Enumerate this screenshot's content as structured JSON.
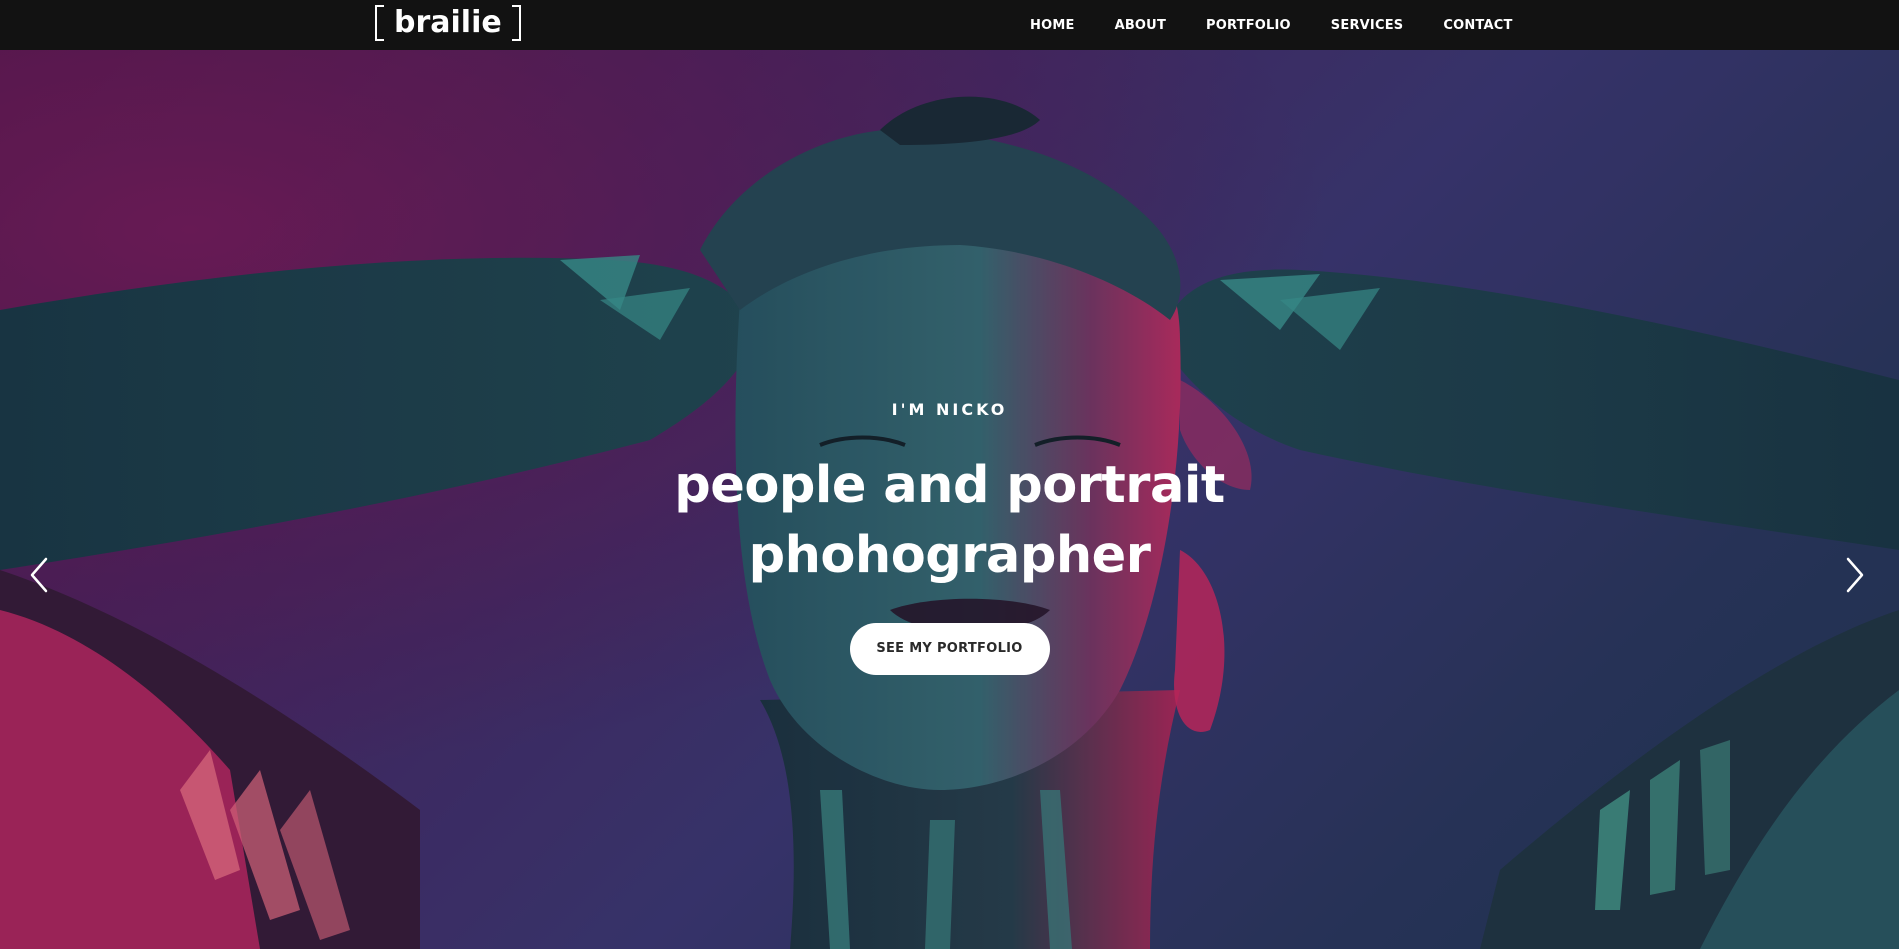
{
  "brand": {
    "logo_text": "brailie"
  },
  "nav": {
    "items": [
      {
        "label": "HOME"
      },
      {
        "label": "ABOUT"
      },
      {
        "label": "PORTFOLIO"
      },
      {
        "label": "SERVICES"
      },
      {
        "label": "CONTACT"
      }
    ]
  },
  "hero": {
    "eyebrow": "I'M NICKO",
    "title": "people and portrait phohographer",
    "button_label": "SEE MY PORTFOLIO"
  },
  "slider": {
    "prev_icon": "chevron-left-icon",
    "next_icon": "chevron-right-icon"
  },
  "colors": {
    "navbar": "#121212",
    "hero_purple": "#5a1a55",
    "hero_violet": "#3e3a78",
    "pink_light": "#e0306a",
    "teal_light": "#2a5a66",
    "button_bg": "#ffffff",
    "button_text": "#2a2a2a"
  }
}
